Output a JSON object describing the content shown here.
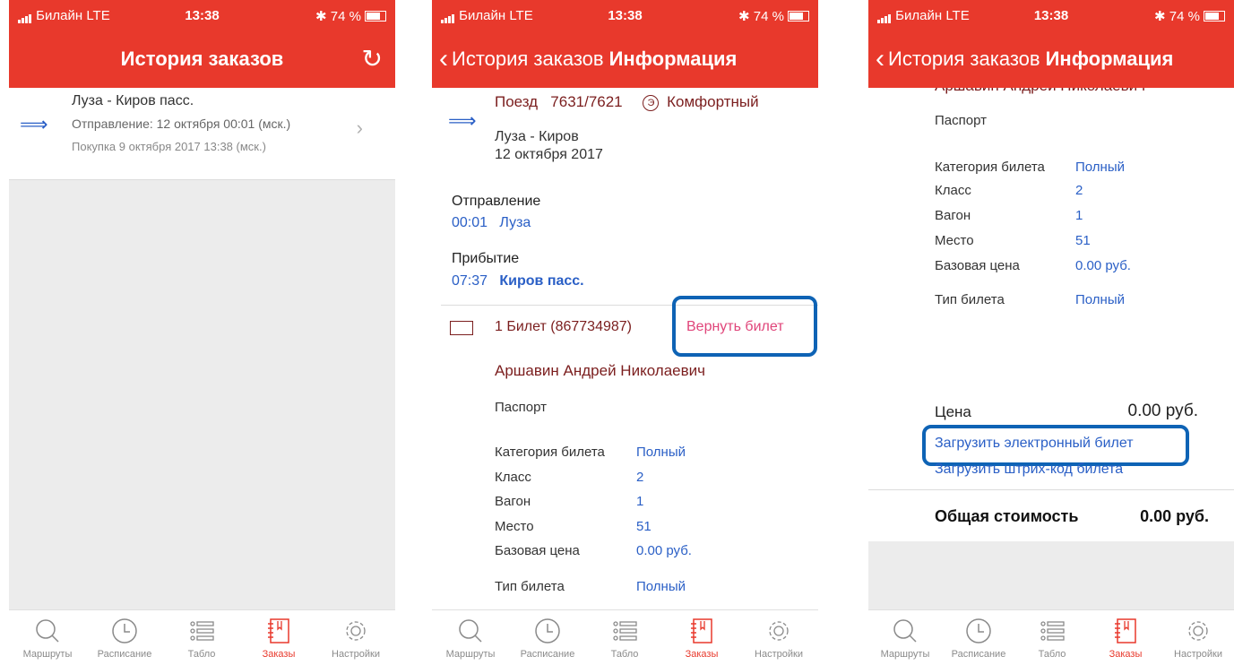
{
  "status": {
    "carrier": "Билайн",
    "network": "LTE",
    "time": "13:38",
    "battery": "74 %"
  },
  "screen1": {
    "title": "История заказов",
    "order": {
      "route": "Луза - Киров пасс.",
      "departure": "Отправление: 12 октября 00:01 (мск.)",
      "purchase": "Покупка 9 октября 2017 13:38 (мск.)"
    }
  },
  "screen2": {
    "back": "История заказов",
    "title": "Информация",
    "train_label": "Поезд",
    "train_number": "7631/7621",
    "class_badge": "Э",
    "class_name": "Комфортный",
    "route": "Луза - Киров",
    "date": "12 октября 2017",
    "departure_label": "Отправление",
    "departure_time": "00:01",
    "departure_station": "Луза",
    "arrival_label": "Прибытие",
    "arrival_time": "07:37",
    "arrival_station": "Киров пасс.",
    "ticket": "1 Билет (867734987)",
    "return_button": "Вернуть билет",
    "passenger": "Аршавин Андрей Николаевич",
    "document": "Паспорт",
    "fields": [
      {
        "label": "Категория билета",
        "value": "Полный"
      },
      {
        "label": "Класс",
        "value": "2"
      },
      {
        "label": "Вагон",
        "value": "1"
      },
      {
        "label": "Место",
        "value": "51"
      },
      {
        "label": "Базовая цена",
        "value": "0.00 руб."
      },
      {
        "label": "Тип билета",
        "value": "Полный"
      }
    ]
  },
  "screen3": {
    "back": "История заказов",
    "title": "Информация",
    "cut_name": "Аршавин Андрей Николаевич",
    "document": "Паспорт",
    "fields": [
      {
        "label": "Категория билета",
        "value": "Полный"
      },
      {
        "label": "Класс",
        "value": "2"
      },
      {
        "label": "Вагон",
        "value": "1"
      },
      {
        "label": "Место",
        "value": "51"
      },
      {
        "label": "Базовая цена",
        "value": "0.00 руб."
      },
      {
        "label": "Тип билета",
        "value": "Полный"
      }
    ],
    "price_label": "Цена",
    "price_value": "0.00 руб.",
    "download_ticket": "Загрузить электронный билет",
    "download_barcode": "Загрузить штрих-код билета",
    "total_label": "Общая стоимость",
    "total_value": "0.00 руб."
  },
  "tabs": [
    {
      "label": "Маршруты",
      "icon": "search-icon"
    },
    {
      "label": "Расписание",
      "icon": "clock-icon"
    },
    {
      "label": "Табло",
      "icon": "list-icon"
    },
    {
      "label": "Заказы",
      "icon": "orders-icon"
    },
    {
      "label": "Настройки",
      "icon": "gear-icon"
    }
  ],
  "colors": {
    "accent": "#e8392c",
    "link": "#2a5fc6",
    "dark_red": "#7b1e1e",
    "highlight": "#0e63b5"
  }
}
